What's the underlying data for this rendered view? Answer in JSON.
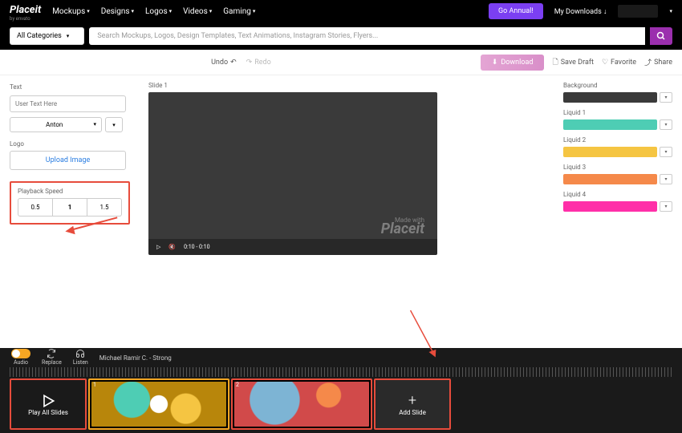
{
  "brand": {
    "name": "Placeit",
    "byline": "by envato"
  },
  "nav": {
    "items": [
      "Mockups",
      "Designs",
      "Logos",
      "Videos",
      "Gaming"
    ],
    "go_annual": "Go Annual!",
    "my_downloads": "My Downloads"
  },
  "search": {
    "category": "All Categories",
    "placeholder": "Search Mockups, Logos, Design Templates, Text Animations, Instagram Stories, Flyers..."
  },
  "actions": {
    "undo": "Undo",
    "redo": "Redo",
    "download": "Download",
    "save_draft": "Save Draft",
    "favorite": "Favorite",
    "share": "Share"
  },
  "left": {
    "text_label": "Text",
    "text_placeholder": "User Text Here",
    "font": "Anton",
    "logo_label": "Logo",
    "upload": "Upload Image",
    "speed_label": "Playback Speed",
    "speeds": [
      "0.5",
      "1",
      "1.5"
    ]
  },
  "center": {
    "slide_label": "Slide 1",
    "time": "0:10 - 0:10",
    "watermark_small": "Made with",
    "watermark": "Placeit"
  },
  "right": {
    "items": [
      {
        "label": "Background",
        "color": "#3a3a3a"
      },
      {
        "label": "Liquid 1",
        "color": "#4ecdb4"
      },
      {
        "label": "Liquid 2",
        "color": "#f5c542"
      },
      {
        "label": "Liquid 3",
        "color": "#f5894a"
      },
      {
        "label": "Liquid 4",
        "color": "#ff2fa8"
      }
    ]
  },
  "timeline": {
    "audio_label": "Audio",
    "replace": "Replace",
    "listen": "Listen",
    "track": "Michael Ramir C. - Strong",
    "play_all": "Play All Slides",
    "add_slide": "Add Slide",
    "slides": [
      {
        "n": "1"
      },
      {
        "n": "2"
      }
    ]
  }
}
